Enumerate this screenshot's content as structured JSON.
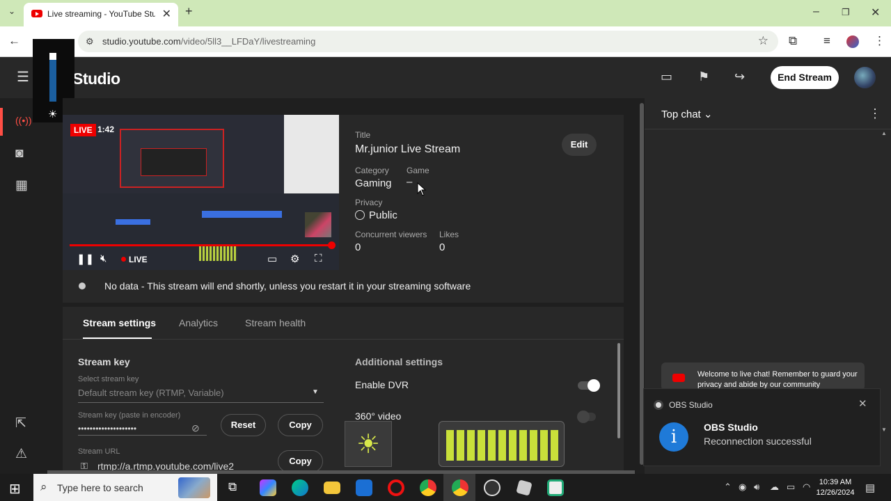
{
  "browser": {
    "tab_title": "Live streaming - YouTube Studi",
    "url_host": "studio.youtube.com",
    "url_path": "/video/5ll3__LFDaY/livestreaming"
  },
  "header": {
    "logo_text": "Studio",
    "end_stream_label": "End Stream"
  },
  "player": {
    "live_badge": "LIVE",
    "elapsed": "1:42",
    "live_label": "LIVE"
  },
  "details": {
    "title_label": "Title",
    "title_value": "Mr.junior Live Stream",
    "edit_label": "Edit",
    "category_label": "Category",
    "category_value": "Gaming",
    "game_label": "Game",
    "game_value": "–",
    "privacy_label": "Privacy",
    "privacy_value": "Public",
    "viewers_label": "Concurrent viewers",
    "viewers_value": "0",
    "likes_label": "Likes",
    "likes_value": "0"
  },
  "status_message": "No data - This stream will end shortly, unless you restart it in your streaming software",
  "tabs": [
    {
      "label": "Stream settings"
    },
    {
      "label": "Analytics"
    },
    {
      "label": "Stream health"
    }
  ],
  "settings": {
    "stream_key_title": "Stream key",
    "select_key_label": "Select stream key",
    "select_key_value": "Default stream key (RTMP, Variable)",
    "key_paste_label": "Stream key (paste in encoder)",
    "key_masked": "••••••••••••••••••••",
    "reset_label": "Reset",
    "copy_label": "Copy",
    "stream_url_label": "Stream URL",
    "stream_url_value": "rtmp://a.rtmp.youtube.com/live2",
    "copy2_label": "Copy",
    "additional_title": "Additional settings",
    "dvr_label": "Enable DVR",
    "dvr_on": true,
    "video360_label": "360° video",
    "video360_on": false
  },
  "chat": {
    "top_chat_label": "Top chat",
    "welcome": "Welcome to live chat! Remember to guard your privacy and abide by our community"
  },
  "toast": {
    "app_name": "OBS Studio",
    "heading": "OBS Studio",
    "body": "Reconnection successful"
  },
  "taskbar": {
    "search_placeholder": "Type here to search",
    "time": "10:39 AM",
    "date": "12/26/2024"
  },
  "colors": {
    "accent_red": "#ff0000",
    "toast_info_blue": "#1f7ad8",
    "meter_green": "#c9e03a"
  }
}
